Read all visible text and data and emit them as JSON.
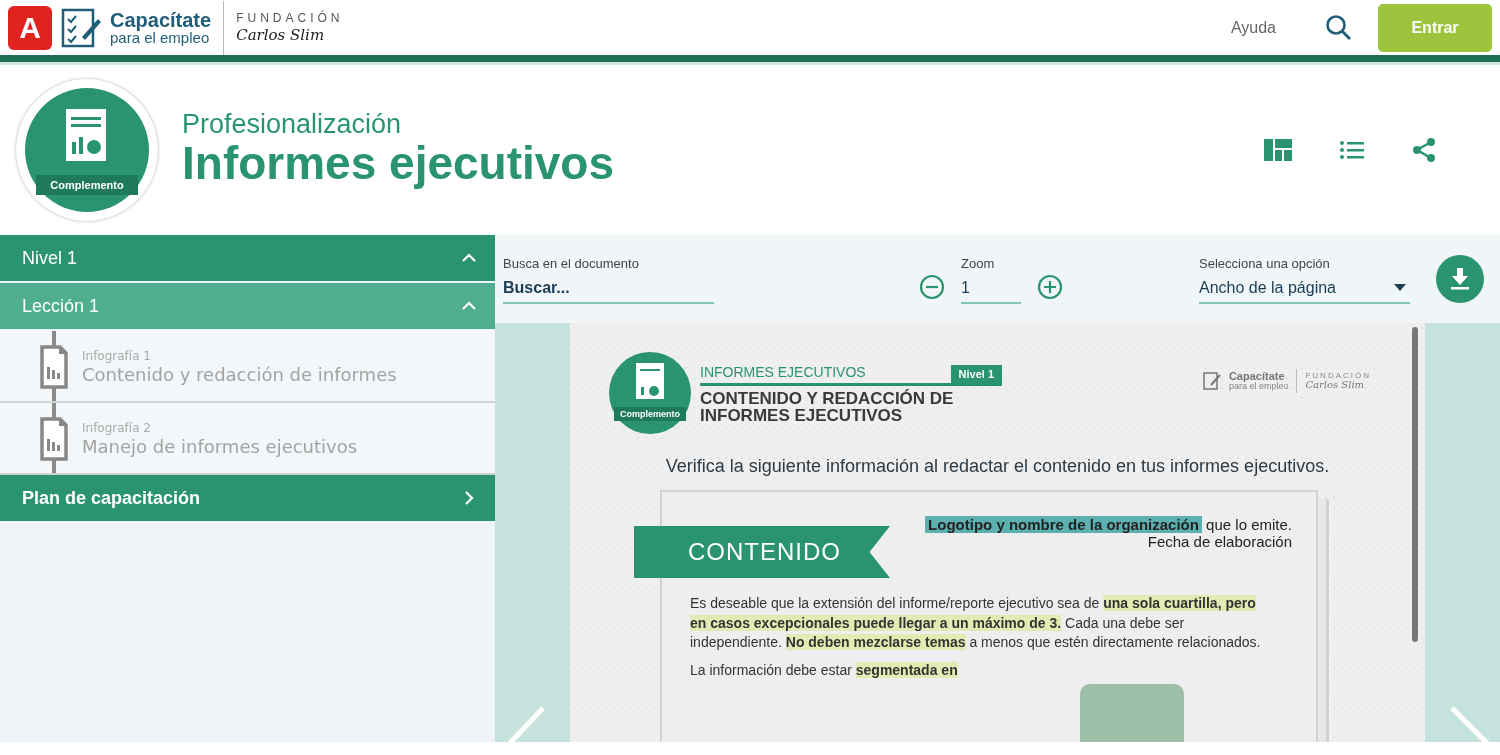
{
  "header": {
    "logo_letter": "A",
    "brand": "Capacítate",
    "brand_sub": "para el empleo",
    "foundation": "FUNDACIÓN",
    "foundation_name": "Carlos Slim",
    "help": "Ayuda",
    "login": "Entrar"
  },
  "course": {
    "badge": "Complemento",
    "category": "Profesionalización",
    "title": "Informes ejecutivos"
  },
  "sidebar": {
    "sections": [
      {
        "kind": "level",
        "label": "Nivel 1",
        "expanded": true,
        "children": [
          {
            "kind": "lesson",
            "label": "Lección 1",
            "expanded": true,
            "children": [
              {
                "kind": "resource",
                "caption": "Infografía 1",
                "label": "Contenido y redacción de informes"
              },
              {
                "kind": "resource",
                "caption": "Infografía 2",
                "label": "Manejo de informes ejecutivos"
              }
            ]
          }
        ]
      },
      {
        "kind": "link",
        "label": "Plan de capacitación",
        "expanded": false
      }
    ]
  },
  "toolbar": {
    "search_label": "Busca en el documento",
    "search_placeholder": "Buscar...",
    "zoom_label": "Zoom",
    "zoom_value": "1",
    "option_label": "Selecciona una opción",
    "option_value": "Ancho de la página"
  },
  "document": {
    "badge": "Complemento",
    "series": "INFORMES EJECUTIVOS",
    "level": "Nivel 1",
    "title": "CONTENIDO Y REDACCIÓN DE INFORMES EJECUTIVOS",
    "brand": "Capacítate",
    "brand_sub": "para el empleo",
    "foundation": "FUNDACIÓN",
    "foundation_name": "Carlos Slim",
    "intro": "Verifica la siguiente información al redactar el contenido en tus informes ejecutivos.",
    "ribbon": "CONTENIDO",
    "org_note": "**Logotipo  y nombre de la organización** que lo emite.",
    "date_note": "Fecha de elaboración",
    "paragraphs": [
      "Es deseable que la extensión del informe/reporte ejecutivo sea de **una sola cuartilla, pero en casos excepcionales puede llegar a un máximo de 3.** Cada una debe ser independiente. **No deben mezclarse temas** a menos que estén directamente relacionados.",
      "La información debe estar **segmentada en**"
    ]
  }
}
